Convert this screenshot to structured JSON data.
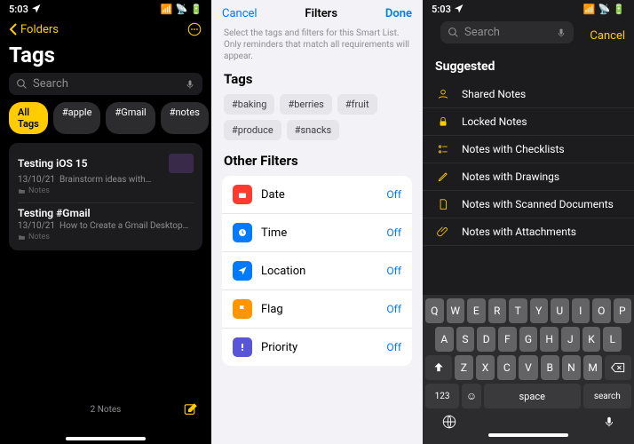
{
  "status": {
    "time": "5:03",
    "loc_icon": "location",
    "signal": "signal",
    "wifi": "wifi",
    "battery": "battery"
  },
  "panel1": {
    "back_label": "Folders",
    "title": "Tags",
    "search_placeholder": "Search",
    "tags": {
      "all": "All Tags",
      "t1": "#apple",
      "t2": "#Gmail",
      "t3": "#notes"
    },
    "notes": [
      {
        "title": "Testing iOS 15",
        "date": "13/10/21",
        "preview": "Brainstorm ideas with…",
        "folder": "Notes",
        "thumb": ""
      },
      {
        "title": "Testing #Gmail",
        "date": "13/10/21",
        "preview": "How to Create a Gmail Desktop…",
        "folder": "Notes"
      }
    ],
    "count": "2 Notes"
  },
  "panel2": {
    "cancel": "Cancel",
    "title": "Filters",
    "done": "Done",
    "hint": "Select the tags and filters for this Smart List. Only reminders that match all requirements will appear.",
    "tags_header": "Tags",
    "tags": [
      "#baking",
      "#berries",
      "#fruit",
      "#produce",
      "#snacks"
    ],
    "other_header": "Other Filters",
    "filters": [
      {
        "label": "Date",
        "value": "Off",
        "color": "#ff3b30"
      },
      {
        "label": "Time",
        "value": "Off",
        "color": "#007aff"
      },
      {
        "label": "Location",
        "value": "Off",
        "color": "#007aff"
      },
      {
        "label": "Flag",
        "value": "Off",
        "color": "#ff9500"
      },
      {
        "label": "Priority",
        "value": "Off",
        "color": "#5856d6"
      }
    ]
  },
  "panel3": {
    "search_placeholder": "Search",
    "cancel": "Cancel",
    "section": "Suggested",
    "suggestions": [
      {
        "label": "Shared Notes",
        "color": "#ffcc00"
      },
      {
        "label": "Locked Notes",
        "color": "#ffcc00"
      },
      {
        "label": "Notes with Checklists",
        "color": "#ffcc00"
      },
      {
        "label": "Notes with Drawings",
        "color": "#ffcc00"
      },
      {
        "label": "Notes with Scanned Documents",
        "color": "#ffcc00"
      },
      {
        "label": "Notes with Attachments",
        "color": "#ffcc00"
      }
    ],
    "keyboard": {
      "row1": [
        "Q",
        "W",
        "E",
        "R",
        "T",
        "Y",
        "U",
        "I",
        "O",
        "P"
      ],
      "row2": [
        "A",
        "S",
        "D",
        "F",
        "G",
        "H",
        "J",
        "K",
        "L"
      ],
      "row3": [
        "Z",
        "X",
        "C",
        "V",
        "B",
        "N",
        "M"
      ],
      "num": "123",
      "space": "space",
      "search": "search"
    }
  }
}
